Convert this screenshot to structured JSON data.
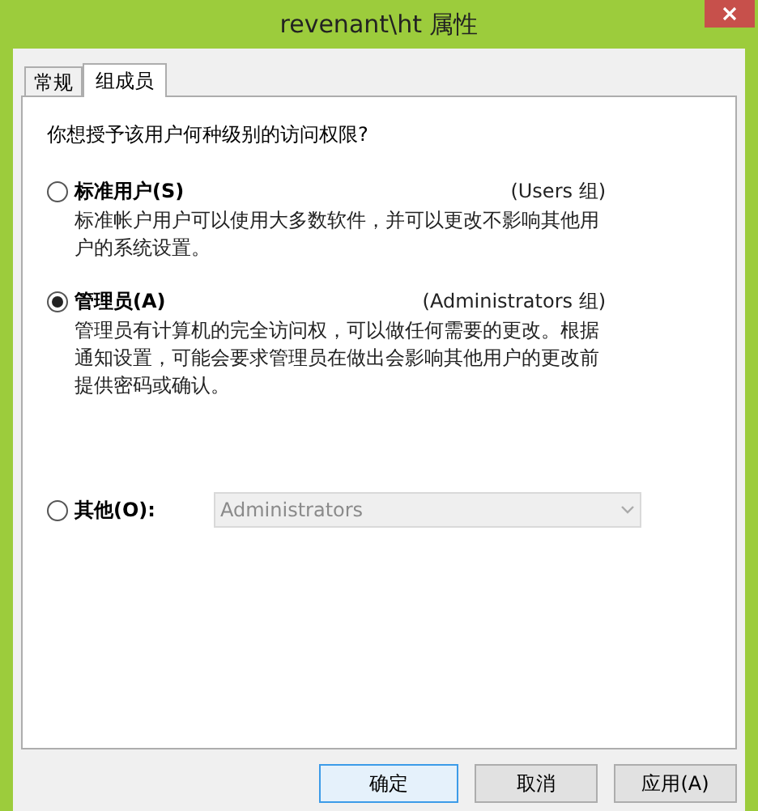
{
  "window": {
    "title": "revenant\\ht 属性"
  },
  "tabs": [
    {
      "label": "常规",
      "selected": false
    },
    {
      "label": "组成员",
      "selected": true
    }
  ],
  "question": "你想授予该用户何种级别的访问权限?",
  "options": [
    {
      "kind": "plain",
      "label": "标准用户(S)",
      "group": "(Users 组)",
      "selected": false,
      "description": "标准帐户用户可以使用大多数软件，并可以更改不影响其他用户的系统设置。"
    },
    {
      "kind": "plain",
      "label": "管理员(A)",
      "group": "(Administrators 组)",
      "selected": true,
      "description": "管理员有计算机的完全访问权，可以做任何需要的更改。根据通知设置，可能会要求管理员在做出会影响其他用户的更改前提供密码或确认。"
    },
    {
      "kind": "dropdown",
      "label": "其他(O):",
      "selected": false,
      "value": "Administrators",
      "disabled": true
    }
  ],
  "buttons": [
    {
      "label": "确定",
      "default": true
    },
    {
      "label": "取消",
      "default": false
    },
    {
      "label": "应用(A)",
      "default": false
    }
  ]
}
